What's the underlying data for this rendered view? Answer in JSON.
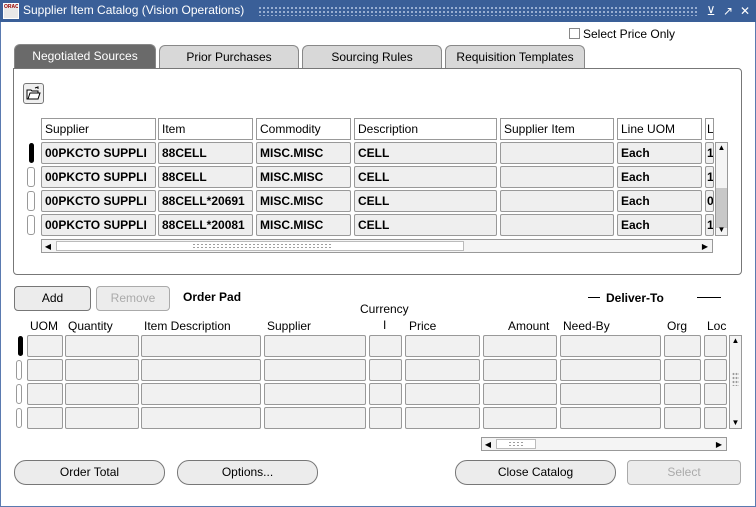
{
  "window": {
    "title": "Supplier Item Catalog (Vision Operations)",
    "logo_text": "ORACLE"
  },
  "select_price_only": {
    "label": "Select Price Only",
    "checked": false
  },
  "tabs": [
    {
      "label": "Negotiated Sources",
      "active": true
    },
    {
      "label": "Prior Purchases",
      "active": false
    },
    {
      "label": "Sourcing Rules",
      "active": false
    },
    {
      "label": "Requisition Templates",
      "active": false
    }
  ],
  "sources_table": {
    "columns": [
      "Supplier",
      "Item",
      "Commodity",
      "Description",
      "Supplier Item",
      "Line UOM",
      "L"
    ],
    "rows": [
      {
        "supplier": "00PKCTO SUPPLI",
        "item": "88CELL",
        "commodity": "MISC.MISC",
        "description": "CELL",
        "supplier_item": "",
        "line_uom": "Each",
        "l": "1"
      },
      {
        "supplier": "00PKCTO SUPPLI",
        "item": "88CELL",
        "commodity": "MISC.MISC",
        "description": "CELL",
        "supplier_item": "",
        "line_uom": "Each",
        "l": "1"
      },
      {
        "supplier": "00PKCTO SUPPLI",
        "item": "88CELL*20691",
        "commodity": "MISC.MISC",
        "description": "CELL",
        "supplier_item": "",
        "line_uom": "Each",
        "l": "0"
      },
      {
        "supplier": "00PKCTO SUPPLI",
        "item": "88CELL*20081",
        "commodity": "MISC.MISC",
        "description": "CELL",
        "supplier_item": "",
        "line_uom": "Each",
        "l": "1"
      }
    ]
  },
  "buttons": {
    "add": "Add",
    "remove": "Remove",
    "order_total": "Order Total",
    "options": "Options...",
    "close_catalog": "Close Catalog",
    "select": "Select"
  },
  "order_pad": {
    "label": "Order Pad",
    "deliver_to": "Deliver-To",
    "currency_label": "Currency",
    "currency_sub": "I",
    "columns": [
      "UOM",
      "Quantity",
      "Item Description",
      "Supplier",
      "Price",
      "Amount",
      "Need-By",
      "Org",
      "Loc"
    ]
  },
  "icons": {
    "folder": "open-folder-icon",
    "scroll_up": "▲",
    "scroll_down": "▼",
    "scroll_left": "◀",
    "scroll_right": "▶"
  }
}
